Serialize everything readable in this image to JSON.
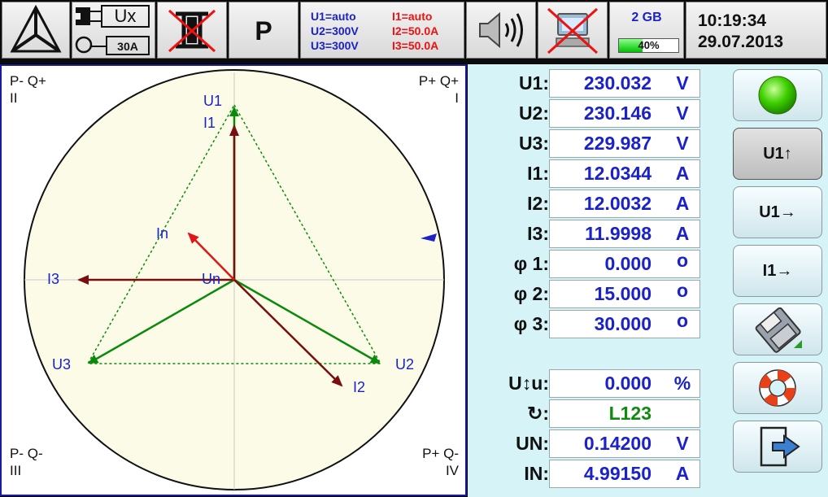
{
  "toolbar": {
    "connection_label": "Ux",
    "clamp_label": "30A",
    "mode_label": "P",
    "ranges": {
      "u1": "U1=auto",
      "u2": "U2=300V",
      "u3": "U3=300V",
      "i1": "I1=auto",
      "i2": "I2=50.0A",
      "i3": "I3=50.0A"
    },
    "memory_size": "2 GB",
    "memory_used_label": "40%",
    "memory_used_fraction": 0.4,
    "time": "10:19:34",
    "date": "29.07.2013"
  },
  "phasor": {
    "quadrants": {
      "tl_top": "P- Q+",
      "tl_num": "II",
      "tr_top": "P+ Q+",
      "tr_num": "I",
      "bl_top": "P- Q-",
      "bl_num": "III",
      "br_top": "P+ Q-",
      "br_num": "IV"
    },
    "labels": {
      "u1": "U1",
      "i1": "I1",
      "u2": "U2",
      "i2": "I2",
      "u3": "U3",
      "i3": "I3",
      "in": "In",
      "un": "Un"
    }
  },
  "measurements": [
    {
      "label": "U1:",
      "value": "230.032",
      "unit": "V"
    },
    {
      "label": "U2:",
      "value": "230.146",
      "unit": "V"
    },
    {
      "label": "U3:",
      "value": "229.987",
      "unit": "V"
    },
    {
      "label": "I1:",
      "value": "12.0344",
      "unit": "A"
    },
    {
      "label": "I2:",
      "value": "12.0032",
      "unit": "A"
    },
    {
      "label": "I3:",
      "value": "11.9998",
      "unit": "A"
    },
    {
      "label": "φ 1:",
      "value": "0.000",
      "unit": "o"
    },
    {
      "label": "φ 2:",
      "value": "15.000",
      "unit": "o"
    },
    {
      "label": "φ 3:",
      "value": "30.000",
      "unit": "o"
    }
  ],
  "extra_measurements": [
    {
      "label": "U↕u:",
      "value": "0.000",
      "unit": "%"
    },
    {
      "label": "↻:",
      "value": "L123",
      "unit": ""
    },
    {
      "label": "UN:",
      "value": "0.14200",
      "unit": "V"
    },
    {
      "label": "IN:",
      "value": "4.99150",
      "unit": "A"
    }
  ],
  "side_buttons": {
    "u1_up": "U1↑",
    "u1_right": "U1→",
    "i1_right": "I1→"
  },
  "colors": {
    "voltage": "#0a8a0a",
    "current": "#7a0d0d",
    "neutral_current": "#e01515",
    "label_blue": "#1a22c8",
    "status_green": "#22b000"
  }
}
